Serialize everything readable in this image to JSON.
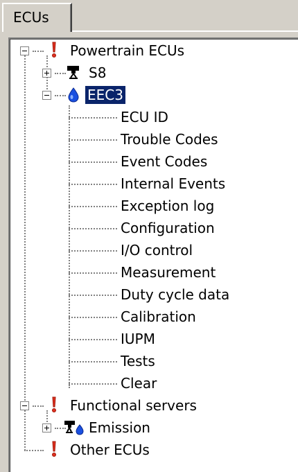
{
  "tab": {
    "label": "ECUs"
  },
  "tree": {
    "powertrain": {
      "label": "Powertrain ECUs"
    },
    "s8": {
      "label": "S8"
    },
    "eec3": {
      "label": "EEC3",
      "children": [
        "ECU ID",
        "Trouble Codes",
        "Event Codes",
        "Internal Events",
        "Exception log",
        "Configuration",
        "I/O control",
        "Measurement",
        "Duty cycle data",
        "Calibration",
        "IUPM",
        "Tests",
        "Clear"
      ]
    },
    "functional_servers": {
      "label": "Functional servers"
    },
    "emission": {
      "label": "Emission"
    },
    "other_ecus": {
      "label": "Other ECUs"
    }
  },
  "colors": {
    "selection": "#0a246a",
    "ecu_red": "#e03020",
    "ecu_blue": "#1a50e0",
    "window_bg": "#d4d0c8"
  },
  "icons": {
    "powertrain": "red-exclamation-ecu-icon",
    "s8": "black-connector-ecu-icon",
    "eec3": "blue-drop-ecu-icon",
    "emission": "connector-drop-ecu-icon"
  }
}
